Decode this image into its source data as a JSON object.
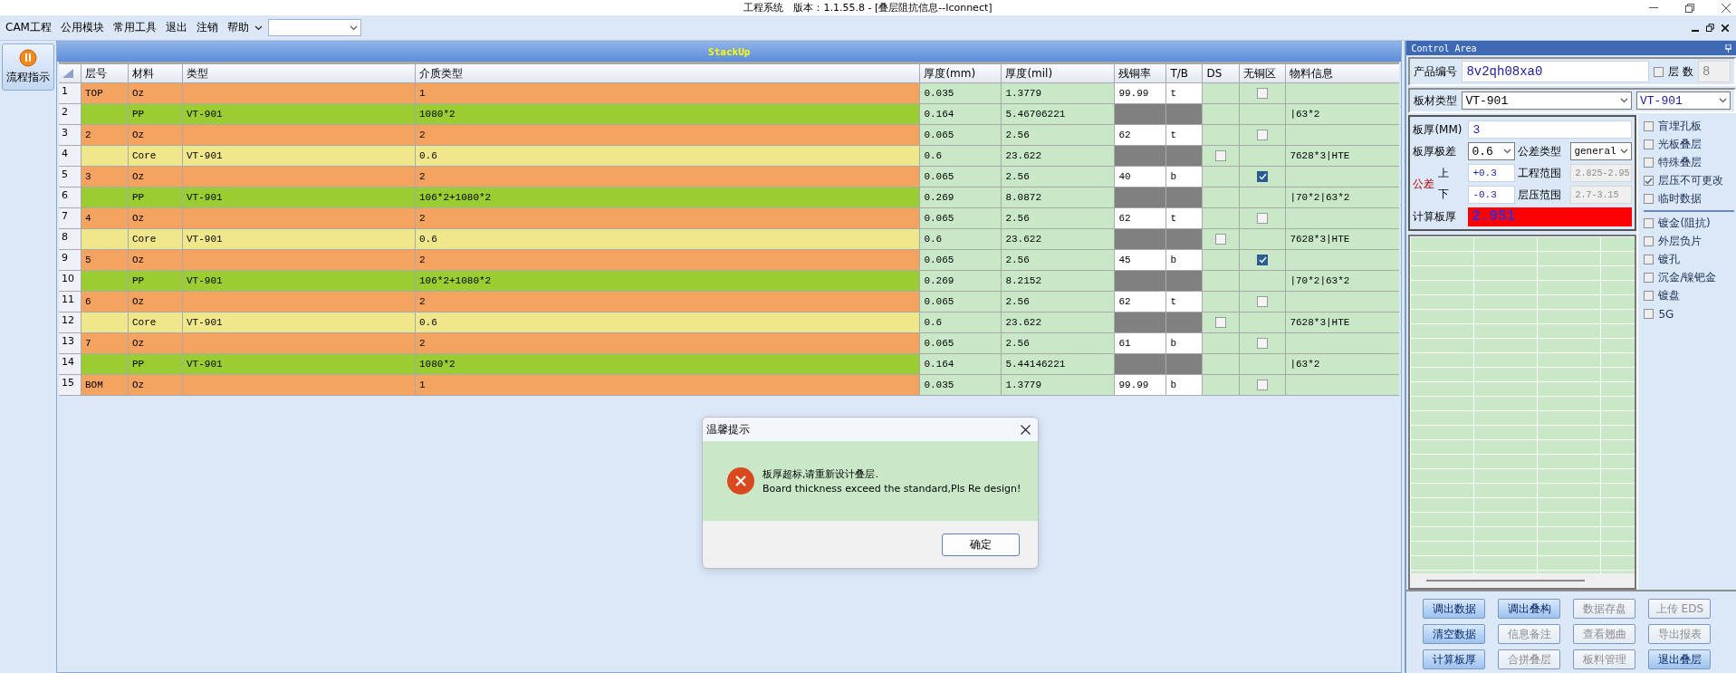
{
  "window": {
    "title": "工程系统　版本：1.1.55.8 - [叠层阻抗信息--Iconnect]"
  },
  "menu": [
    {
      "label": "CAM工程",
      "kind": "plain"
    },
    {
      "label": "公用模块",
      "kind": "plain"
    },
    {
      "label": "常用工具",
      "kind": "plain"
    },
    {
      "label": "退出",
      "kind": "plain"
    },
    {
      "label": "注销",
      "kind": "plain"
    },
    {
      "label": "帮助",
      "kind": "dropdown"
    }
  ],
  "sidebar": {
    "button": "流程指示"
  },
  "stackup": {
    "title": "StackUp",
    "columns": [
      "层号",
      "材料",
      "类型",
      "介质类型",
      "厚度(mm)",
      "厚度(mil)",
      "残铜率",
      "T/B",
      "DS",
      "无铜区",
      "物料信息"
    ],
    "rows": [
      {
        "num": "1",
        "kind": "copper",
        "layer": "TOP",
        "material": "Oz",
        "type": "",
        "dielectric": "1",
        "mm": "0.035",
        "mil": "1.3779",
        "residual": "99.99",
        "tb": "t",
        "no_copper": false,
        "info": ""
      },
      {
        "num": "2",
        "kind": "prepreg",
        "layer": "",
        "material": "PP",
        "type": "VT-901",
        "dielectric": "1080*2",
        "mm": "0.164",
        "mil": "5.46706221",
        "info": "|63*2"
      },
      {
        "num": "3",
        "kind": "copper",
        "layer": "2",
        "material": "Oz",
        "type": "",
        "dielectric": "2",
        "mm": "0.065",
        "mil": "2.56",
        "residual": "62",
        "tb": "t",
        "no_copper": false,
        "info": ""
      },
      {
        "num": "4",
        "kind": "core",
        "layer": "",
        "material": "Core",
        "type": "VT-901",
        "dielectric": "0.6",
        "mm": "0.6",
        "mil": "23.622",
        "ds": false,
        "info": "7628*3|HTE"
      },
      {
        "num": "5",
        "kind": "copper",
        "layer": "3",
        "material": "Oz",
        "type": "",
        "dielectric": "2",
        "mm": "0.065",
        "mil": "2.56",
        "residual": "40",
        "tb": "b",
        "no_copper": true,
        "info": ""
      },
      {
        "num": "6",
        "kind": "prepreg",
        "layer": "",
        "material": "PP",
        "type": "VT-901",
        "dielectric": "106*2+1080*2",
        "mm": "0.269",
        "mil": "8.0872",
        "info": "|70*2|63*2"
      },
      {
        "num": "7",
        "kind": "copper",
        "layer": "4",
        "material": "Oz",
        "type": "",
        "dielectric": "2",
        "mm": "0.065",
        "mil": "2.56",
        "residual": "62",
        "tb": "t",
        "no_copper": false,
        "info": ""
      },
      {
        "num": "8",
        "kind": "core",
        "layer": "",
        "material": "Core",
        "type": "VT-901",
        "dielectric": "0.6",
        "mm": "0.6",
        "mil": "23.622",
        "ds": false,
        "info": "7628*3|HTE"
      },
      {
        "num": "9",
        "kind": "copper",
        "layer": "5",
        "material": "Oz",
        "type": "",
        "dielectric": "2",
        "mm": "0.065",
        "mil": "2.56",
        "residual": "45",
        "tb": "b",
        "no_copper": true,
        "info": ""
      },
      {
        "num": "10",
        "kind": "prepreg",
        "layer": "",
        "material": "PP",
        "type": "VT-901",
        "dielectric": "106*2+1080*2",
        "mm": "0.269",
        "mil": "8.2152",
        "info": "|70*2|63*2"
      },
      {
        "num": "11",
        "kind": "copper",
        "layer": "6",
        "material": "Oz",
        "type": "",
        "dielectric": "2",
        "mm": "0.065",
        "mil": "2.56",
        "residual": "62",
        "tb": "t",
        "no_copper": false,
        "info": ""
      },
      {
        "num": "12",
        "kind": "core",
        "layer": "",
        "material": "Core",
        "type": "VT-901",
        "dielectric": "0.6",
        "mm": "0.6",
        "mil": "23.622",
        "ds": false,
        "info": "7628*3|HTE"
      },
      {
        "num": "13",
        "kind": "copper",
        "layer": "7",
        "material": "Oz",
        "type": "",
        "dielectric": "2",
        "mm": "0.065",
        "mil": "2.56",
        "residual": "61",
        "tb": "b",
        "no_copper": false,
        "info": ""
      },
      {
        "num": "14",
        "kind": "prepreg",
        "layer": "",
        "material": "PP",
        "type": "VT-901",
        "dielectric": "1080*2",
        "mm": "0.164",
        "mil": "5.44146221",
        "info": "|63*2"
      },
      {
        "num": "15",
        "kind": "copper",
        "layer": "BOM",
        "material": "Oz",
        "type": "",
        "dielectric": "1",
        "mm": "0.035",
        "mil": "1.3779",
        "residual": "99.99",
        "tb": "b",
        "no_copper": false,
        "info": ""
      }
    ]
  },
  "control_area": {
    "title": "Control Area",
    "product_no": {
      "label": "产品编号",
      "value": "8v2qh08xa0"
    },
    "layer_count": {
      "label": "层 数",
      "checked": false,
      "value": "8",
      "disabled": true
    },
    "board_type": {
      "label": "板材类型",
      "value": "VT-901",
      "value_2": "VT-901"
    },
    "thickness": {
      "label": "板厚(MM)",
      "value": "3"
    },
    "thickness_range": {
      "label": "板厚极差",
      "value": "0.6"
    },
    "tolerance_type": {
      "label": "公差类型",
      "value": "general"
    },
    "tolerance": {
      "label": "公差",
      "upper_label": "上",
      "upper": "+0.3",
      "lower_label": "下",
      "lower": "-0.3"
    },
    "eng_range": {
      "label": "工程范围",
      "value": "2.825-2.95",
      "disabled": true
    },
    "press_range": {
      "label": "层压范围",
      "value": "2.7-3.15",
      "disabled": true
    },
    "calc_thickness": {
      "label": "计算板厚",
      "value": "2.951",
      "exceeded": true
    },
    "options": [
      {
        "label": "盲埋孔板",
        "checked": false
      },
      {
        "label": "光板叠层",
        "checked": false
      },
      {
        "label": "特殊叠层",
        "checked": false
      },
      {
        "label": "层压不可更改",
        "checked": true
      },
      {
        "label": "临时数据",
        "checked": false
      }
    ],
    "options_2": [
      {
        "label": "镀金(阻抗)",
        "checked": false
      },
      {
        "label": "外层负片",
        "checked": false
      },
      {
        "label": "镀孔",
        "checked": false
      },
      {
        "label": "沉金/镍钯金",
        "checked": false
      },
      {
        "label": "镀盘",
        "checked": false
      },
      {
        "label": "5G",
        "checked": false
      }
    ],
    "buttons": [
      {
        "label": "调出数据",
        "disabled": false
      },
      {
        "label": "调出叠构",
        "disabled": false
      },
      {
        "label": "数据存盘",
        "disabled": true
      },
      {
        "label": "上传 EDS",
        "disabled": true
      },
      {
        "label": "清空数据",
        "disabled": false
      },
      {
        "label": "信息备注",
        "disabled": true
      },
      {
        "label": "查看翘曲",
        "disabled": true
      },
      {
        "label": "导出报表",
        "disabled": true
      },
      {
        "label": "计算板厚",
        "disabled": false
      },
      {
        "label": "合拼叠层",
        "disabled": true
      },
      {
        "label": "板料管理",
        "disabled": true
      },
      {
        "label": "退出叠层",
        "disabled": false
      }
    ]
  },
  "dialog": {
    "title": "温馨提示",
    "message": "板厚超标,请重新设计叠层.",
    "message_2": "Board thickness exceed the standard,Pls Re design!",
    "button": "确定"
  }
}
